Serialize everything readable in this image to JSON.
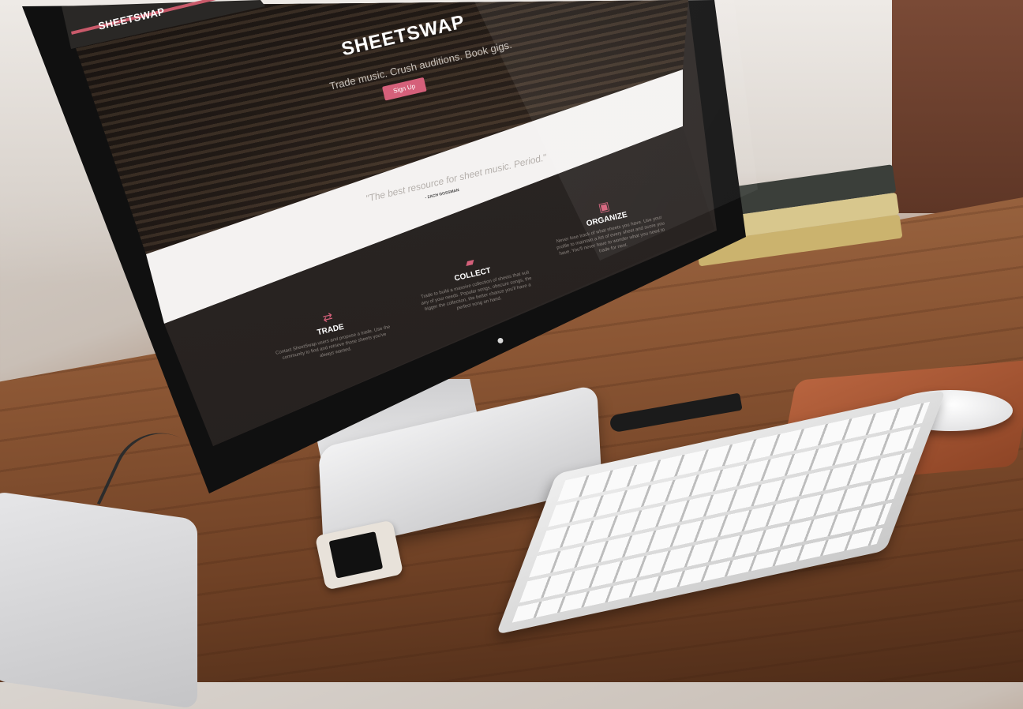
{
  "site": {
    "brand": "SHEETSWAP"
  },
  "hero": {
    "title": "SHEETSWAP",
    "tagline": "Trade music. Crush auditions. Book gigs.",
    "cta_label": "Sign Up"
  },
  "quote": {
    "text": "\"The best resource for sheet music. Period.\"",
    "author": "- ZACH GOSSMAN"
  },
  "features": [
    {
      "icon": "arrows-swap-icon",
      "glyph": "⇄",
      "title": "TRADE",
      "description": "Contact SheetSwap users and propose a trade. Use the community to find and retrieve those sheets you've always wanted."
    },
    {
      "icon": "folder-icon",
      "glyph": "▰",
      "title": "COLLECT",
      "description": "Trade to build a massive collection of sheets that suit any of your needs. Popular songs, obscure songs, the bigger the collection, the better chance you'll have a perfect song on hand."
    },
    {
      "icon": "archive-box-icon",
      "glyph": "▣",
      "title": "ORGANIZE",
      "description": "Never lose track of what sheets you have. Use your profile to maintain a list of every sheet and score you have. You'll never have to wonder what you need to trade for next."
    }
  ],
  "colors": {
    "accent": "#d5607a",
    "navbar": "#2a2826",
    "quote_band": "#f4f2f1",
    "features_bg": "#2c2725"
  }
}
